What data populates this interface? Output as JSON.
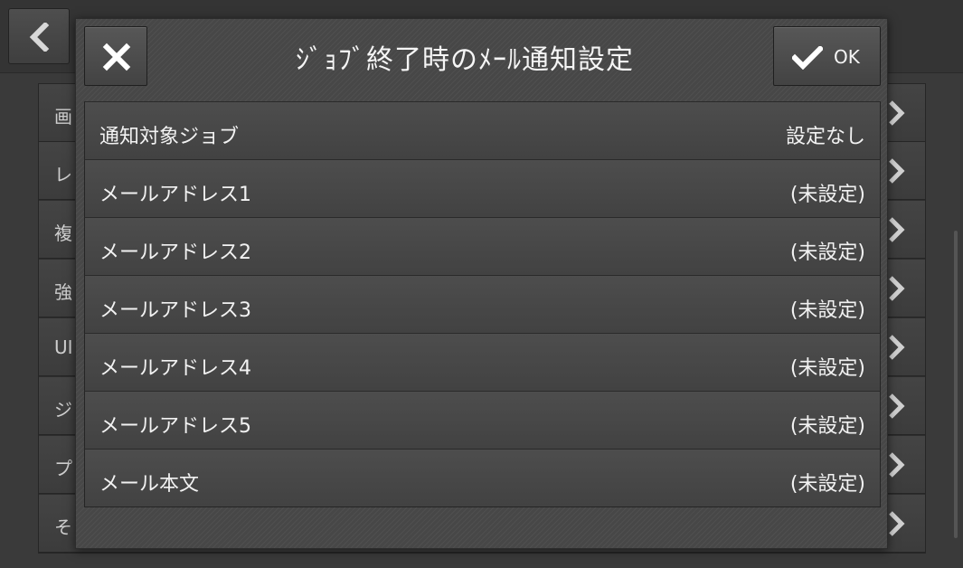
{
  "background": {
    "back_icon": "chevron-left-icon",
    "items": [
      {
        "label": "画"
      },
      {
        "label": "レ"
      },
      {
        "label": "複"
      },
      {
        "label": "強"
      },
      {
        "label": "UI"
      },
      {
        "label": "ジ"
      },
      {
        "label": "プ"
      },
      {
        "label": "そ"
      }
    ],
    "chevron_icon": "chevron-right-icon"
  },
  "dialog": {
    "title": "ｼﾞｮﾌﾞ終了時のﾒｰﾙ通知設定",
    "close_icon": "close-x-icon",
    "ok_icon": "checkmark-icon",
    "ok_label": "OK",
    "rows": [
      {
        "label": "通知対象ジョブ",
        "value": "設定なし"
      },
      {
        "label": "メールアドレス1",
        "value": "(未設定)"
      },
      {
        "label": "メールアドレス2",
        "value": "(未設定)"
      },
      {
        "label": "メールアドレス3",
        "value": "(未設定)"
      },
      {
        "label": "メールアドレス4",
        "value": "(未設定)"
      },
      {
        "label": "メールアドレス5",
        "value": "(未設定)"
      },
      {
        "label": "メール本文",
        "value": "(未設定)"
      }
    ]
  },
  "colors": {
    "background": "#3a3a3a",
    "dialog": "#474747",
    "text": "#f2f2f2"
  }
}
